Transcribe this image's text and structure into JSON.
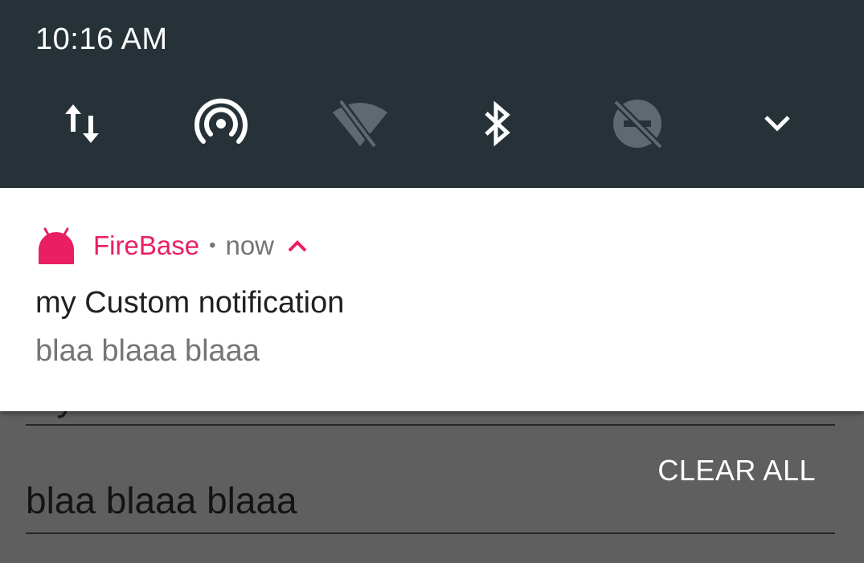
{
  "status_bar": {
    "time": "10:16 AM"
  },
  "quick_settings": {
    "tiles": [
      {
        "icon": "mobile-data-icon"
      },
      {
        "icon": "hotspot-icon"
      },
      {
        "icon": "wifi-off-icon"
      },
      {
        "icon": "bluetooth-icon"
      },
      {
        "icon": "do-not-disturb-off-icon"
      },
      {
        "icon": "expand-chevron-icon"
      }
    ]
  },
  "notification": {
    "app_name": "FireBase",
    "separator": "•",
    "time": "now",
    "title": "my Custom notification",
    "text": "blaa blaaa blaaa",
    "accent_color": "#e91e63"
  },
  "app_behind": {
    "clipped_text": "my",
    "field_text": "blaa blaaa blaaa",
    "clear_all_label": "CLEAR ALL"
  },
  "colors": {
    "panel_bg": "#263238",
    "card_bg": "#ffffff",
    "scrim": "#5f5f5f"
  }
}
